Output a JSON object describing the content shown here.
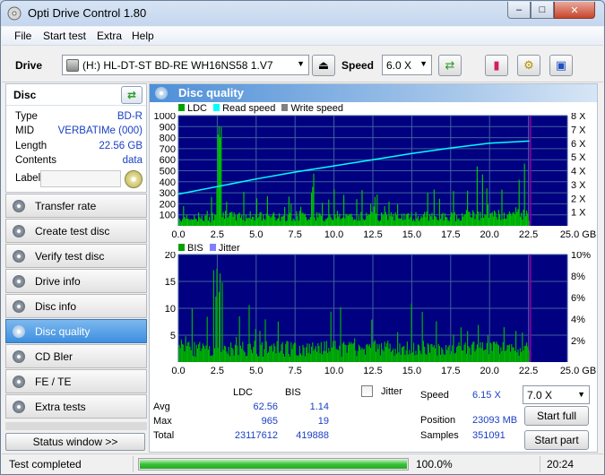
{
  "window": {
    "title": "Opti Drive Control 1.80"
  },
  "menu": [
    "File",
    "Start test",
    "Extra",
    "Help"
  ],
  "toolbar": {
    "drive_label": "Drive",
    "drive_value": "(H:)   HL-DT-ST BD-RE  WH16NS58 1.V7",
    "speed_label": "Speed",
    "speed_value": "6.0 X"
  },
  "disc": {
    "title": "Disc",
    "rows": [
      {
        "k": "Type",
        "v": "BD-R"
      },
      {
        "k": "MID",
        "v": "VERBATIMe (000)"
      },
      {
        "k": "Length",
        "v": "22.56 GB"
      },
      {
        "k": "Contents",
        "v": "data"
      }
    ],
    "label_key": "Label"
  },
  "nav": [
    {
      "label": "Transfer rate",
      "active": false
    },
    {
      "label": "Create test disc",
      "active": false
    },
    {
      "label": "Verify test disc",
      "active": false
    },
    {
      "label": "Drive info",
      "active": false
    },
    {
      "label": "Disc info",
      "active": false
    },
    {
      "label": "Disc quality",
      "active": true
    },
    {
      "label": "CD Bler",
      "active": false
    },
    {
      "label": "FE / TE",
      "active": false
    },
    {
      "label": "Extra tests",
      "active": false
    }
  ],
  "status_window_btn": "Status window >>",
  "panel_title": "Disc quality",
  "legend_top": [
    "LDC",
    "Read speed",
    "Write speed"
  ],
  "legend_bottom": [
    "BIS",
    "Jitter"
  ],
  "colors": {
    "ldc": "#00c000",
    "bis": "#00b000",
    "read_speed": "#00ffff",
    "write_speed": "#808080",
    "jitter": "#8080ff",
    "plot_bg": "#000080",
    "grid": "#4060a0",
    "end_marker": "#8000a0"
  },
  "chart_data": [
    {
      "type": "area",
      "name": "LDC / Read speed",
      "x_ticks": [
        "0.0",
        "2.5",
        "5.0",
        "7.5",
        "10.0",
        "12.5",
        "15.0",
        "17.5",
        "20.0",
        "22.5",
        "25.0 GB"
      ],
      "y_left_ticks": [
        "1000",
        "900",
        "800",
        "700",
        "600",
        "500",
        "400",
        "300",
        "200",
        "100"
      ],
      "y_right_ticks": [
        "8 X",
        "7 X",
        "6 X",
        "5 X",
        "4 X",
        "3 X",
        "2 X",
        "1 X"
      ],
      "ylim_left": [
        0,
        1000
      ],
      "ylim_right": [
        0,
        8
      ],
      "xlim": [
        0,
        25
      ],
      "data_end_gb": 22.56,
      "read_speed": {
        "x": [
          0,
          2.5,
          5,
          7.5,
          10,
          12.5,
          15,
          17.5,
          20,
          22.56
        ],
        "y": [
          2.3,
          2.85,
          3.4,
          3.9,
          4.35,
          4.8,
          5.25,
          5.65,
          6.0,
          6.15
        ]
      }
    },
    {
      "type": "area",
      "name": "BIS / Jitter",
      "x_ticks": [
        "0.0",
        "2.5",
        "5.0",
        "7.5",
        "10.0",
        "12.5",
        "15.0",
        "17.5",
        "20.0",
        "22.5",
        "25.0 GB"
      ],
      "y_left_ticks": [
        "20",
        "15",
        "10",
        "5"
      ],
      "y_right_ticks": [
        "10%",
        "8%",
        "6%",
        "4%",
        "2%"
      ],
      "ylim_left": [
        0,
        20
      ],
      "ylim_right": [
        0,
        10
      ],
      "xlim": [
        0,
        25
      ],
      "data_end_gb": 22.56
    }
  ],
  "stats": {
    "col_ldc": "LDC",
    "col_bis": "BIS",
    "rows": [
      {
        "k": "Avg",
        "ldc": "62.56",
        "bis": "1.14"
      },
      {
        "k": "Max",
        "ldc": "965",
        "bis": "19"
      },
      {
        "k": "Total",
        "ldc": "23117612",
        "bis": "419888"
      }
    ],
    "jitter_label": "Jitter",
    "speed_label": "Speed",
    "speed_value": "6.15 X",
    "position_label": "Position",
    "position_value": "23093 MB",
    "samples_label": "Samples",
    "samples_value": "351091",
    "speed_select": "7.0 X",
    "start_full": "Start full",
    "start_part": "Start part"
  },
  "status": {
    "text": "Test completed",
    "progress": 100.0,
    "progress_text": "100.0%",
    "clock": "20:24"
  }
}
